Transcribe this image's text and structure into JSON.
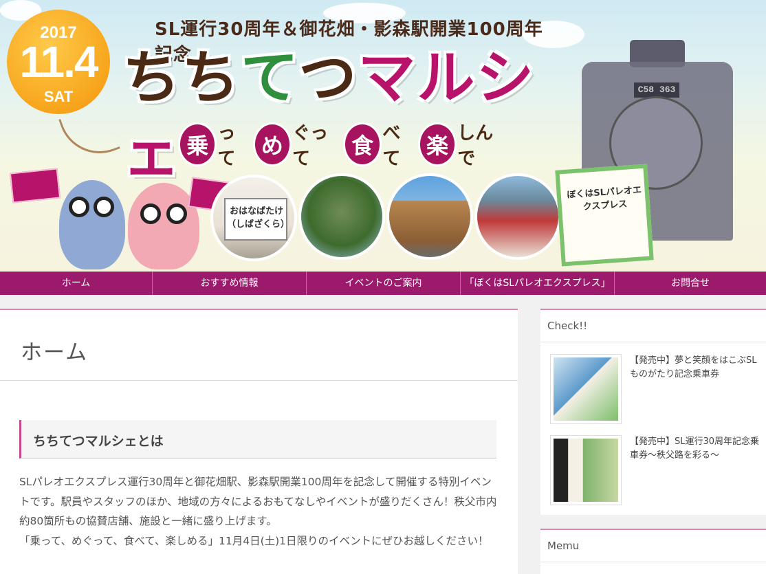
{
  "banner": {
    "year": "2017",
    "date": "11.4",
    "day": "SAT",
    "subtitle": "SL運行30周年＆御花畑・影森駅開業100周年記念",
    "title_part1": "ちち",
    "title_part2": "て",
    "title_part3": "つ",
    "title_part4": "マルシェ",
    "catch": [
      {
        "circle": "乗",
        "rest": "って"
      },
      {
        "circle": "め",
        "rest": "ぐって"
      },
      {
        "circle": "食",
        "rest": "べて"
      },
      {
        "circle": "楽",
        "rest": "しんで"
      }
    ],
    "station_sign": "おはなばたけ（しばざくら）",
    "book_title": "ぼくはSLパレオエクスプレス",
    "train_plate": "C58 363"
  },
  "nav": {
    "items": [
      {
        "label": "ホーム"
      },
      {
        "label": "おすすめ情報"
      },
      {
        "label": "イベントのご案内"
      },
      {
        "label": "「ぼくはSLパレオエクスプレス」"
      },
      {
        "label": "お問合せ"
      }
    ]
  },
  "main": {
    "page_title": "ホーム",
    "section_title": "ちちてつマルシェとは",
    "paragraph1": "SLパレオエクスプレス運行30周年と御花畑駅、影森駅開業100周年を記念して開催する特別イベントです。駅員やスタッフのほか、地域の方々によるおもてなしやイベントが盛りだくさん！秩父市内約80箇所もの協賛店舗、施設と一緒に盛り上げます。",
    "paragraph2": "「乗って、めぐって、食べて、楽しめる」11月4日(土)1日限りのイベントにぜひお越しください！"
  },
  "sidebar": {
    "check_title": "Check!!",
    "posts": [
      {
        "title": "【発売中】夢と笑顔をはこぶSLものがたり記念乗車券"
      },
      {
        "title": "【発売中】SL運行30周年記念乗車券～秩父路を彩る～"
      }
    ],
    "menu_title": "Memu"
  },
  "colors": {
    "nav_bg": "#9c1a6b",
    "accent_pink": "#d788b2",
    "balloon": "#f7a51c",
    "title_brown": "#4a2a14",
    "title_green": "#2f8f3d",
    "title_magenta": "#b8136a"
  }
}
